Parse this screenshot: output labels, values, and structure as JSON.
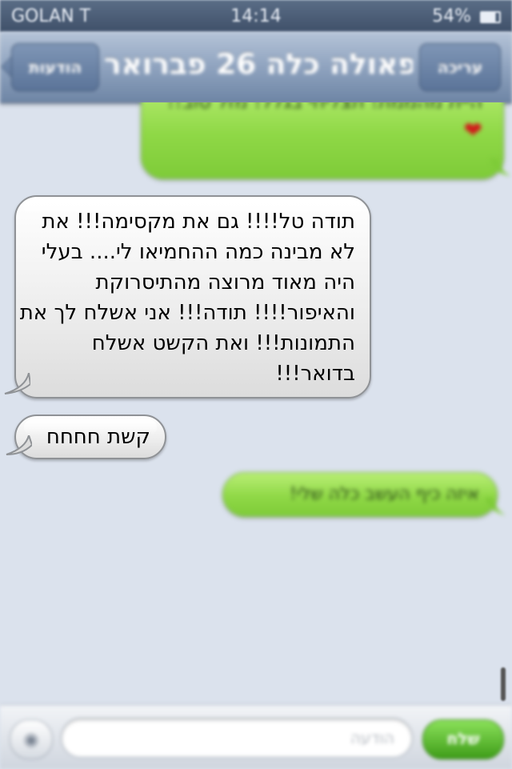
{
  "status_bar": {
    "carrier": "GOLAN T",
    "time": "14:14",
    "battery": "54%"
  },
  "nav": {
    "title": "פאולה כלה 26 פברואר",
    "back_label": "הודעות",
    "edit_label": "עריכה"
  },
  "messages": [
    {
      "direction": "outgoing",
      "text": "היית מהממת! תצליחי בגלל! מזל טוב!!",
      "emoji": "heart-icon"
    },
    {
      "direction": "incoming",
      "text": "תודה טל!!!! גם את מקסימה!!! את לא מבינה כמה ההחמיאו לי.... בעלי היה מאוד מרוצה מהתיסרוקת והאיפור!!!! תודה!!! אני אשלח לך את התמונות!!! ואת הקשט אשלח בדואר!!!"
    },
    {
      "direction": "incoming",
      "text": "קשת חחחח"
    },
    {
      "direction": "outgoing",
      "text": "איזה כיף העשב כלה שלי!"
    }
  ],
  "composer": {
    "placeholder": "הודעה",
    "send_label": "שלח",
    "camera_icon": "camera-icon"
  },
  "colors": {
    "outgoing_bubble": "#8fd846",
    "incoming_bubble": "#ececec",
    "nav_bar": "#8fa3bf",
    "background": "#dbe2ed"
  }
}
